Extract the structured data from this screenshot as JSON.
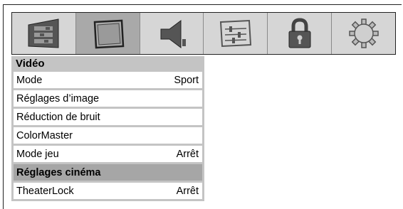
{
  "tabs": [
    {
      "icon": "picture-settings-icon",
      "active": false
    },
    {
      "icon": "video-screen-icon",
      "active": true
    },
    {
      "icon": "audio-speaker-icon",
      "active": false
    },
    {
      "icon": "setup-sliders-icon",
      "active": false
    },
    {
      "icon": "lock-icon",
      "active": false
    },
    {
      "icon": "settings-gear-icon",
      "active": false
    }
  ],
  "menu": {
    "title": "Vidéo",
    "items": [
      {
        "label": "Mode",
        "value": "Sport"
      },
      {
        "label": "Réglages d’image",
        "value": ""
      },
      {
        "label": "Réduction de bruit",
        "value": ""
      },
      {
        "label": "ColorMaster",
        "value": ""
      },
      {
        "label": "Mode jeu",
        "value": "Arrêt"
      },
      {
        "label": "Réglages cinéma",
        "value": "",
        "selected": true
      },
      {
        "label": "TheaterLock",
        "value": "Arrêt"
      }
    ]
  },
  "colors": {
    "tabbar_bg": "#d6d6d6",
    "active_tab_bg": "#a9a9a9",
    "menu_bg": "#c4c4c4",
    "selected_row_bg": "#a6a6a6"
  }
}
